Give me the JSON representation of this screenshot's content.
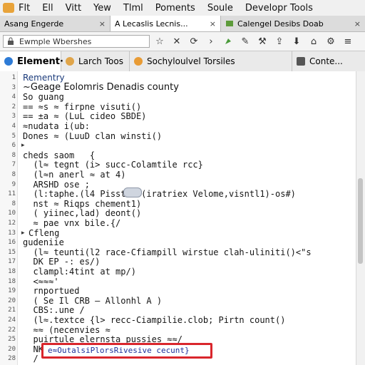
{
  "menubar": {
    "items": [
      "Flt",
      "Ell",
      "Vitt",
      "Yew",
      "Tlml",
      "Poments",
      "Soule",
      "Developr Tools"
    ]
  },
  "tabs": [
    {
      "label": "Asang Engerde",
      "close": "×",
      "active": false
    },
    {
      "label": "A Lecaslis Lecnis...",
      "close": "×",
      "active": true
    },
    {
      "label": "Calengel Desibs Doab",
      "close": "×",
      "active": false
    }
  ],
  "toolbar": {
    "url_value": "Ewmple Wbershes",
    "reload": "⟳",
    "forward": "›"
  },
  "devtools": {
    "tabs": [
      {
        "label": "Element·",
        "active": true,
        "icon_color": "#2e7bd6"
      },
      {
        "label": "Larch Toos",
        "active": false,
        "icon_color": "#e0a54a"
      },
      {
        "label": "Sochyloulvel Torsiles",
        "active": false,
        "icon_color": "#e89b35"
      },
      {
        "label": "Conte...",
        "active": false,
        "icon_color": "#555555"
      }
    ]
  },
  "code_lines": [
    {
      "n": "1",
      "text": "Rementry",
      "style": "head1",
      "arrow": ""
    },
    {
      "n": "3",
      "text": "~Geage Eolomris Denadis county",
      "style": "head2",
      "arrow": ""
    },
    {
      "n": "4",
      "text": "So guang",
      "style": "",
      "arrow": ""
    },
    {
      "n": "2",
      "text": "== ≈s ≈ firpne visuti()",
      "style": "",
      "arrow": ""
    },
    {
      "n": "3",
      "text": "== ±a ≈ (LuL cideo SBDE)",
      "style": "",
      "arrow": ""
    },
    {
      "n": "4",
      "text": "≈nudata i(ub:",
      "style": "",
      "arrow": ""
    },
    {
      "n": "5",
      "text": "Dones ≈ (LuuD clan winsti()",
      "style": "",
      "arrow": ""
    },
    {
      "n": "6",
      "text": "",
      "style": "",
      "arrow": "▸"
    },
    {
      "n": "8",
      "text": "cheds saom   {",
      "style": "",
      "arrow": ""
    },
    {
      "n": "7",
      "text": "  (l≈ tegnt (i> succ-Colamtile rcc}",
      "style": "",
      "arrow": ""
    },
    {
      "n": "8",
      "text": "  (l≈n anerl ≈ at 4)",
      "style": "",
      "arrow": ""
    },
    {
      "n": "9",
      "text": "  ARSHD ose ;",
      "style": "",
      "arrow": ""
    },
    {
      "n": "11",
      "text": "  (l:taphe.(l4 Pisstos (iratriex Velome,visntl1)-os#)",
      "style": "",
      "arrow": ""
    },
    {
      "n": "8",
      "text": "  nst ≈ Riqps chement1)",
      "style": "",
      "arrow": ""
    },
    {
      "n": "10",
      "text": "  ( yiinec,lad) deont()",
      "style": "",
      "arrow": ""
    },
    {
      "n": "12",
      "text": "  ≈ pae vnx bile.{/",
      "style": "",
      "arrow": ""
    },
    {
      "n": "13",
      "text": "Cfleng",
      "style": "",
      "arrow": "▸"
    },
    {
      "n": "16",
      "text": "gudeniie",
      "style": "",
      "arrow": ""
    },
    {
      "n": "15",
      "text": "  (l≈ teunti(l2 race-Cfiampill wirstue clah-uliniti()<\"s",
      "style": "",
      "arrow": ""
    },
    {
      "n": "17",
      "text": "  DK EP -: es/)",
      "style": "",
      "arrow": ""
    },
    {
      "n": "18",
      "text": "  clampl:4tint at mp/)",
      "style": "",
      "arrow": ""
    },
    {
      "n": "18",
      "text": "  <≈≈≈'",
      "style": "",
      "arrow": ""
    },
    {
      "n": "19",
      "text": "  rnportued",
      "style": "",
      "arrow": ""
    },
    {
      "n": "20",
      "text": "  ( Se Il CRB — Allonhl A )",
      "style": "",
      "arrow": ""
    },
    {
      "n": "21",
      "text": "  CBS:.une /",
      "style": "",
      "arrow": ""
    },
    {
      "n": "24",
      "text": "  (l≈.textce {l> recc-Ciampilie.clob; Pirtn count()",
      "style": "",
      "arrow": ""
    },
    {
      "n": "22",
      "text": "  ≈≈ (necenvies ≈",
      "style": "",
      "arrow": ""
    },
    {
      "n": "25",
      "text": "  puirtule elernsta_pussies ≈≈/",
      "style": "",
      "arrow": ""
    },
    {
      "n": "20",
      "text": "  NK",
      "style": "",
      "arrow": ""
    },
    {
      "n": "28",
      "text": "  /",
      "style": "",
      "arrow": ""
    }
  ],
  "highlight": {
    "text": "e≈OutalsiPlorsRivesive cecunt}",
    "color": "#d9262c"
  }
}
